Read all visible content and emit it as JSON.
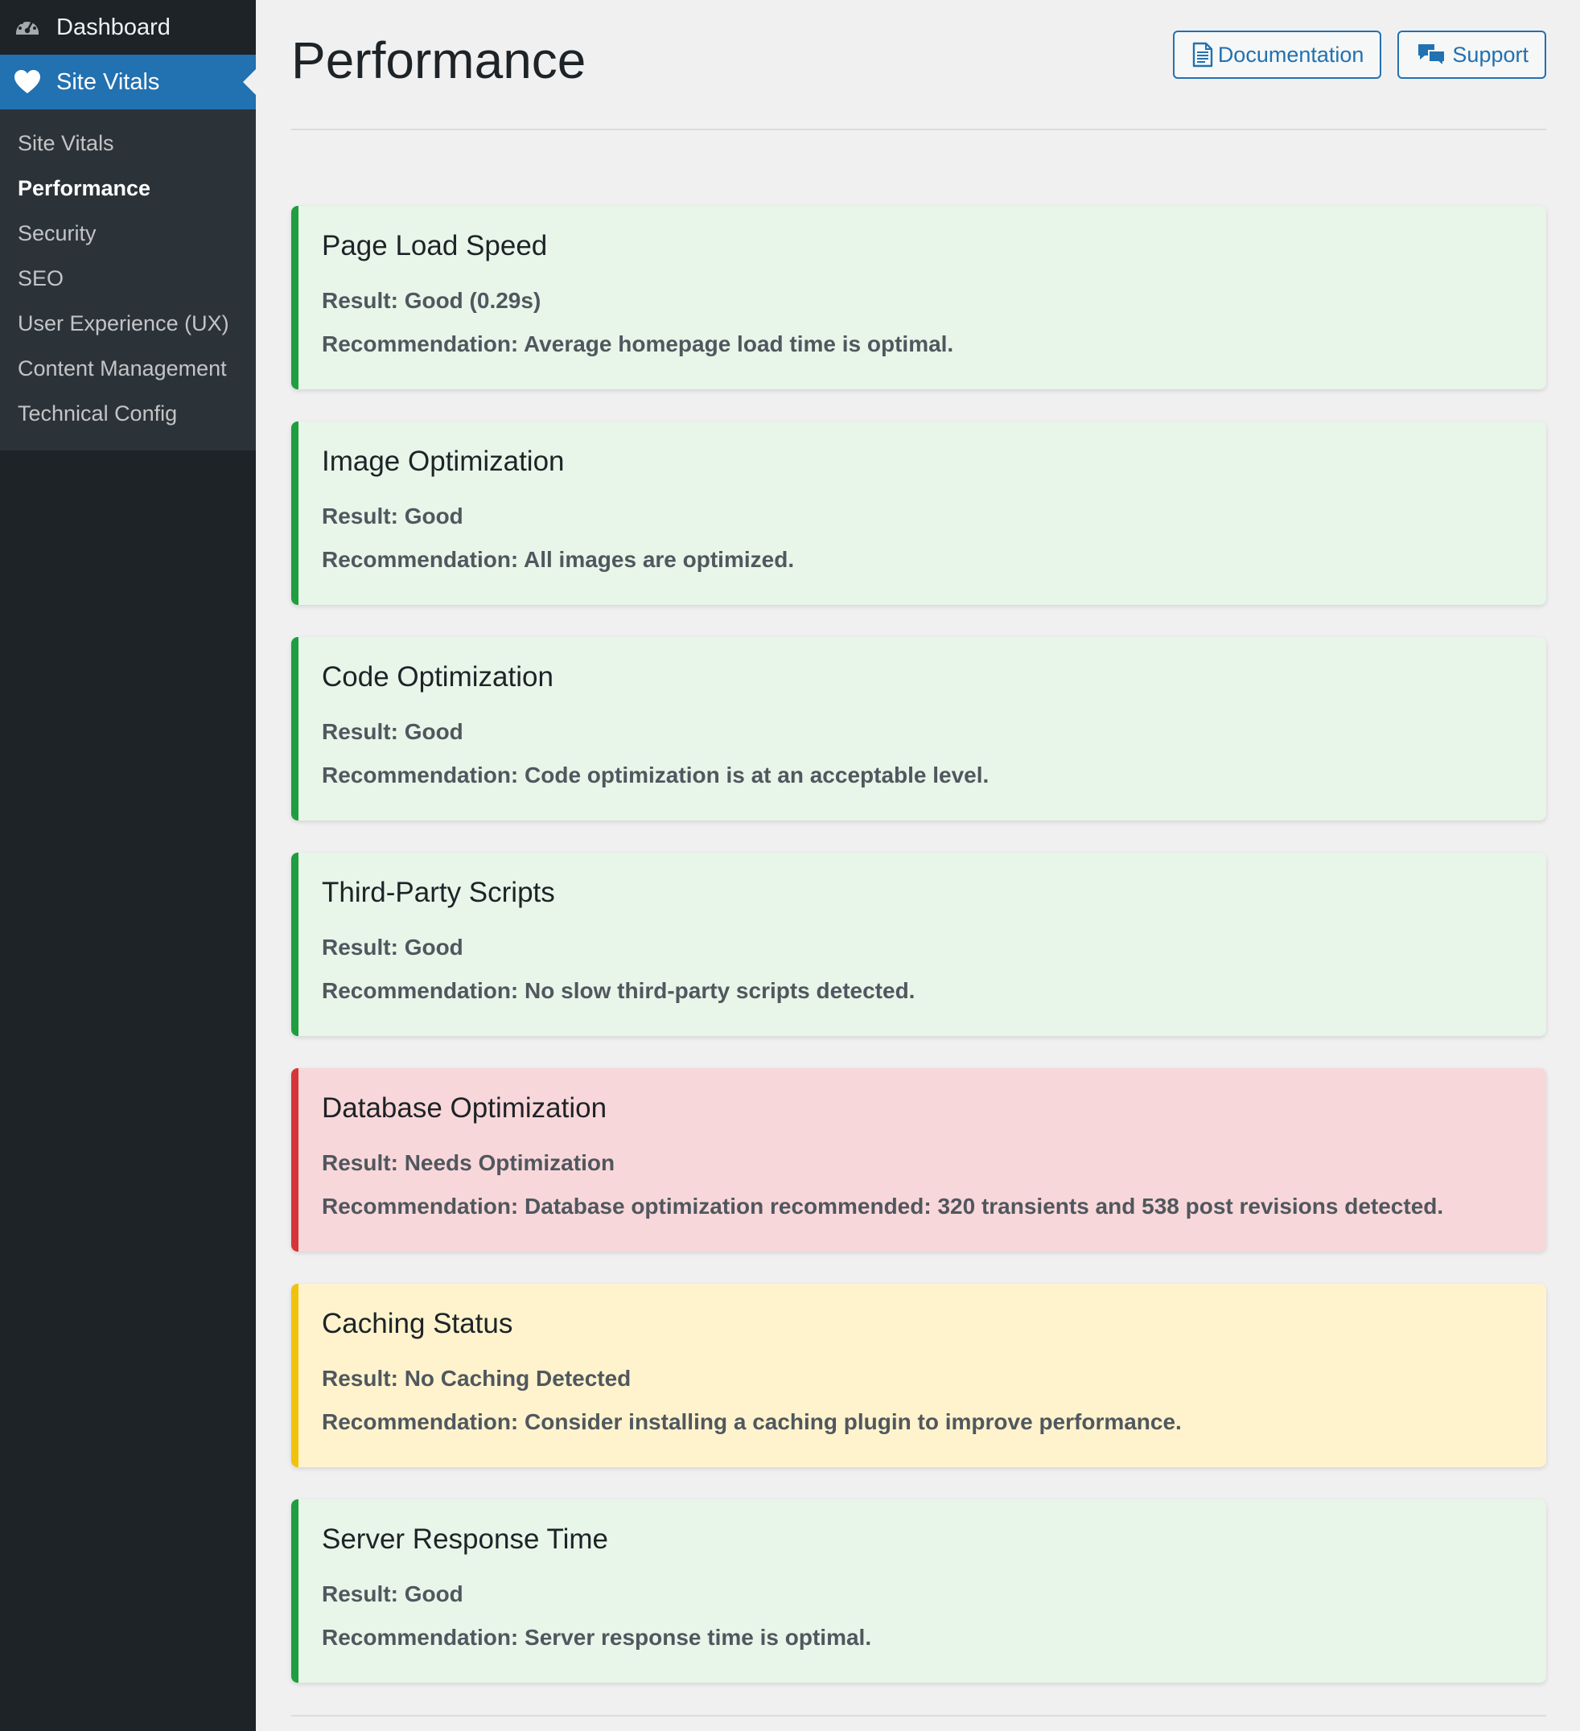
{
  "sidebar": {
    "dashboard_label": "Dashboard",
    "dashboard_icon": "dashboard-gauge-icon",
    "site_vitals_label": "Site Vitals",
    "site_vitals_icon": "heart-icon",
    "submenu": [
      {
        "label": "Site Vitals",
        "active": false
      },
      {
        "label": "Performance",
        "active": true
      },
      {
        "label": "Security",
        "active": false
      },
      {
        "label": "SEO",
        "active": false
      },
      {
        "label": "User Experience (UX)",
        "active": false
      },
      {
        "label": "Content Management",
        "active": false
      },
      {
        "label": "Technical Config",
        "active": false
      }
    ]
  },
  "header": {
    "title": "Performance",
    "documentation_label": "Documentation",
    "documentation_icon": "document-icon",
    "support_label": "Support",
    "support_icon": "chat-bubbles-icon"
  },
  "labels": {
    "result": "Result:",
    "recommendation": "Recommendation:"
  },
  "colors": {
    "good_accent": "#1e9e3e",
    "good_bg": "#e8f5e9",
    "bad_accent": "#d63638",
    "bad_bg": "#f8d7da",
    "warn_accent": "#f0c20c",
    "warn_bg": "#fff3cd"
  },
  "checks": [
    {
      "title": "Page Load Speed",
      "result": "Good (0.29s)",
      "recommendation": "Average homepage load time is optimal.",
      "status": "good"
    },
    {
      "title": "Image Optimization",
      "result": "Good",
      "recommendation": "All images are optimized.",
      "status": "good"
    },
    {
      "title": "Code Optimization",
      "result": "Good",
      "recommendation": "Code optimization is at an acceptable level.",
      "status": "good"
    },
    {
      "title": "Third-Party Scripts",
      "result": "Good",
      "recommendation": "No slow third-party scripts detected.",
      "status": "good"
    },
    {
      "title": "Database Optimization",
      "result": "Needs Optimization",
      "recommendation": "Database optimization recommended: 320 transients and 538 post revisions detected.",
      "status": "bad"
    },
    {
      "title": "Caching Status",
      "result": "No Caching Detected",
      "recommendation": "Consider installing a caching plugin to improve performance.",
      "status": "warn"
    },
    {
      "title": "Server Response Time",
      "result": "Good",
      "recommendation": "Server response time is optimal.",
      "status": "good"
    }
  ]
}
